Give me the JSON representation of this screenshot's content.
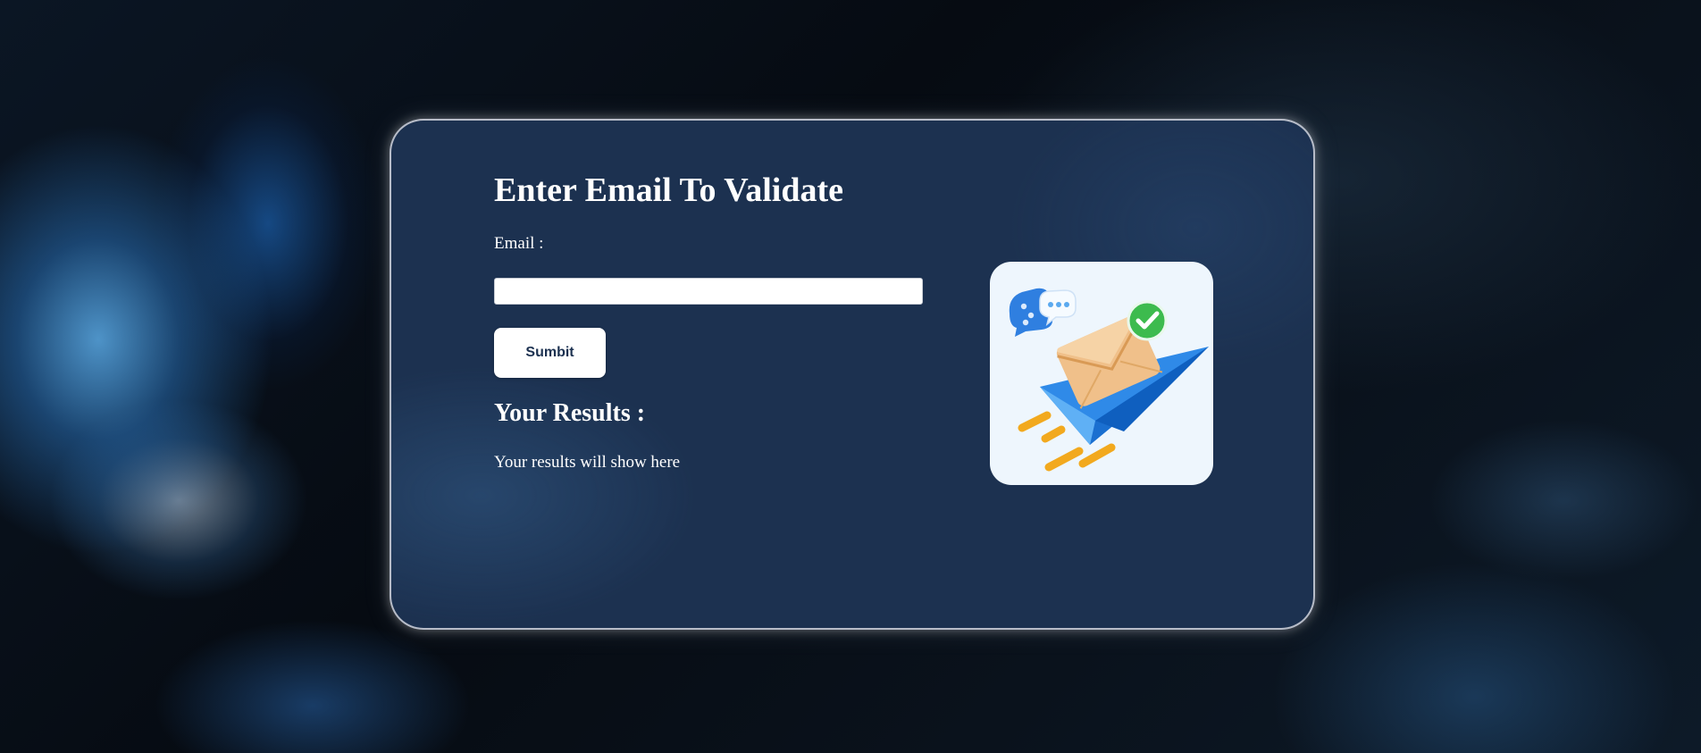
{
  "form": {
    "title": "Enter Email To Validate",
    "email_label": "Email :",
    "email_value": "",
    "email_placeholder": "",
    "submit_label": "Sumbit"
  },
  "results": {
    "title": "Your Results :",
    "text": "Your results will show here"
  },
  "illustration": {
    "icon": "email-paper-plane-verified-icon"
  },
  "colors": {
    "card_background": "#1c3150",
    "card_border": "#ebebf0",
    "button_text": "#1c3150",
    "text": "#ffffff",
    "illustration_background": "#eef6fd",
    "check_badge": "#3dbb4e",
    "paper_plane": "#2f8ae8",
    "envelope": "#f0c08a",
    "speed_lines": "#f2a91e"
  }
}
